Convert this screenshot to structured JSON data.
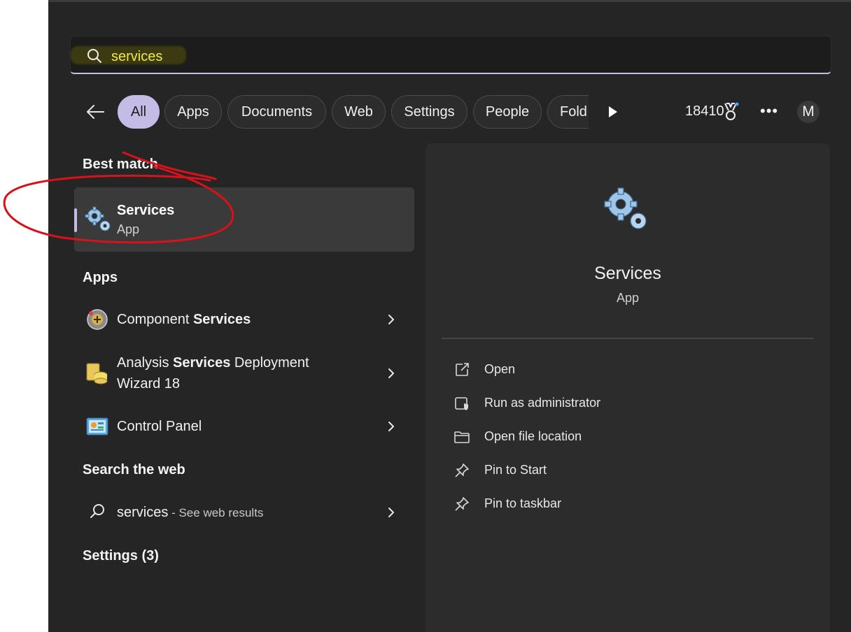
{
  "search": {
    "query": "services"
  },
  "filters": {
    "tabs": [
      {
        "label": "All",
        "active": true
      },
      {
        "label": "Apps"
      },
      {
        "label": "Documents"
      },
      {
        "label": "Web"
      },
      {
        "label": "Settings"
      },
      {
        "label": "People"
      },
      {
        "label": "Fold"
      }
    ],
    "points": "18410",
    "avatar_initial": "M"
  },
  "results": {
    "best_match": {
      "heading": "Best match",
      "title": "Services",
      "subtitle": "App",
      "icon": "gears-icon"
    },
    "apps": {
      "heading": "Apps",
      "items": [
        {
          "prefix": "Component ",
          "bold": "Services",
          "suffix": "",
          "icon": "component-services-icon"
        },
        {
          "prefix": "Analysis ",
          "bold": "Services",
          "suffix": " Deployment",
          "line2": "Wizard 18",
          "icon": "deployment-wizard-icon"
        },
        {
          "prefix": "Control Panel",
          "bold": "",
          "suffix": "",
          "icon": "control-panel-icon"
        }
      ]
    },
    "web": {
      "heading": "Search the web",
      "query": "services",
      "hint": " - See web results"
    },
    "settings_heading": "Settings (3)"
  },
  "detail": {
    "title": "Services",
    "subtitle": "App",
    "actions": [
      {
        "label": "Open",
        "icon": "open-external-icon"
      },
      {
        "label": "Run as administrator",
        "icon": "shield-admin-icon"
      },
      {
        "label": "Open file location",
        "icon": "folder-icon"
      },
      {
        "label": "Pin to Start",
        "icon": "pin-icon"
      },
      {
        "label": "Pin to taskbar",
        "icon": "pin-icon"
      }
    ]
  },
  "colors": {
    "panel": "#252526",
    "accent": "#c4bce6",
    "annotation": "#d8121a",
    "highlight_text": "#f1e84a"
  }
}
